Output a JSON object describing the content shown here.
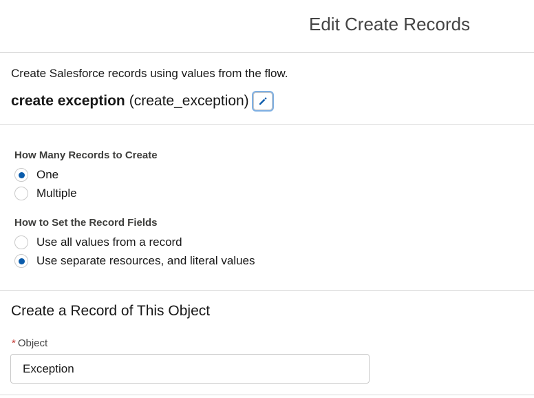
{
  "header": {
    "title": "Edit Create Records"
  },
  "intro": {
    "description": "Create Salesforce records using values from the flow.",
    "element_label": "create exception",
    "element_api_name": "(create_exception)",
    "edit_icon": "pencil-icon"
  },
  "options": {
    "how_many": {
      "label": "How Many Records to Create",
      "choices": [
        {
          "label": "One",
          "selected": true
        },
        {
          "label": "Multiple",
          "selected": false
        }
      ]
    },
    "how_to_set": {
      "label": "How to Set the Record Fields",
      "choices": [
        {
          "label": "Use all values from a record",
          "selected": false
        },
        {
          "label": "Use separate resources, and literal values",
          "selected": true
        }
      ]
    }
  },
  "object_section": {
    "title": "Create a Record of This Object",
    "field_label": "Object",
    "required_marker": "*",
    "value": "Exception"
  },
  "colors": {
    "accent": "#0b5cab",
    "required": "#c23934",
    "border": "#c9c9c9"
  }
}
